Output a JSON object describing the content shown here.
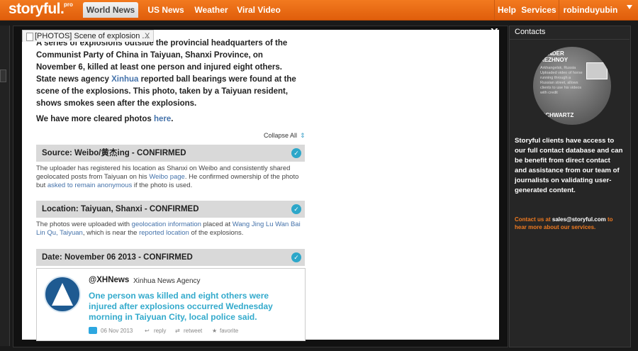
{
  "header": {
    "logo": "storyful.",
    "logo_sup": "pro",
    "tabs": [
      "World News",
      "US News",
      "Weather",
      "Viral Video"
    ],
    "right_links": [
      "Help",
      "Services"
    ],
    "username": "robinduyubin"
  },
  "modal": {
    "tab_title": "[PHOTOS] Scene of explosion ...",
    "tab_close": "X",
    "close": "X",
    "lead_1": "A series of explosions outside the provincial headquarters of the Communist Party of China in Taiyuan, Shanxi Province, on November 6, killed at least one person and injured eight others. State news agency ",
    "lead_link": "Xinhua",
    "lead_2": " reported ball bearings were found at the scene of the explosions. This photo, taken by a Taiyuan resident, shows smokes seen after the explosions.",
    "more_1": "We have more cleared photos ",
    "more_link": "here",
    "more_2": ".",
    "collapse_all": "Collapse All",
    "sections": [
      {
        "title": "Source: Weibo/黄杰ing - CONFIRMED",
        "body_1": "The uploader has registered his location as Shanxi on Weibo and consistently shared geolocated posts from Taiyuan on his ",
        "link_1": "Weibo page",
        "body_2": ". He confirmed ownership of the photo but ",
        "link_2": "asked to remain anonymous",
        "body_3": " if the photo is used."
      },
      {
        "title": "Location: Taiyuan, Shanxi - CONFIRMED",
        "body_1": "The photos were uploaded with ",
        "link_1": "geolocation information",
        "body_2": " placed at ",
        "link_2": "Wang Jing Lu Wan Bai Lin Qu, Taiyuan",
        "body_3": ", which is near the ",
        "link_3": "reported location",
        "body_4": " of the explosions."
      },
      {
        "title": "Date: November 06 2013 - CONFIRMED"
      }
    ],
    "tweet": {
      "handle": "@XHNews",
      "name": "Xinhua News Agency",
      "text": "One person was killed and eight others were injured after explosions occurred Wednesday morning in Taiyuan City, local police said.",
      "date": "06 Nov 2013",
      "reply": "reply",
      "retweet": "retweet",
      "favorite": "favorite"
    }
  },
  "contacts": {
    "title": "Contacts",
    "preview_name_1": "XANDER\nREZHNOY",
    "preview_sub_1": "Arkhangelsk, Russia\nUploaded video of horse running through a Russian street, allows clients to use his videos with credit",
    "preview_name_2": "SCHWARTZ",
    "description": "Storyful clients have access to our full contact database and can be benefit from direct contact and assistance from our team of journalists on validating user-generated content.",
    "contact_prefix": "Contact us at ",
    "email": "sales@storyful.com",
    "contact_suffix": " to hear more about our services."
  }
}
